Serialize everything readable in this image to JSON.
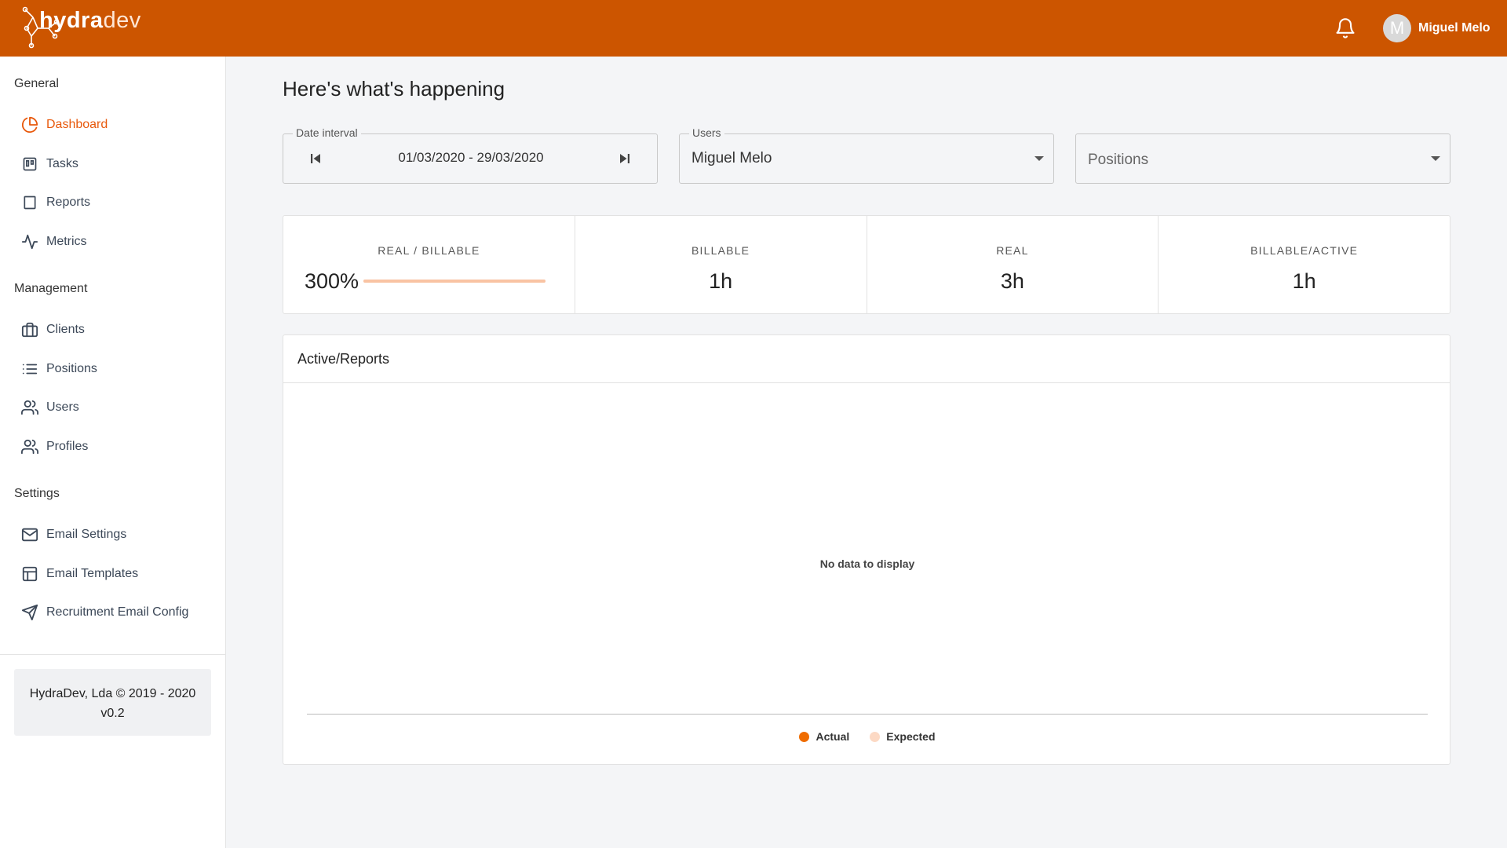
{
  "header": {
    "logo_text_bold": "hydra",
    "logo_text_light": "dev",
    "user_name": "Miguel Melo",
    "avatar_initial": "M",
    "brand_color": "#cc5500"
  },
  "sidebar": {
    "sections": {
      "general": "General",
      "management": "Management",
      "settings": "Settings"
    },
    "items": [
      {
        "label": "Dashboard",
        "icon": "pie-chart-icon",
        "active": true
      },
      {
        "label": "Tasks",
        "icon": "kanban-icon"
      },
      {
        "label": "Reports",
        "icon": "document-icon"
      },
      {
        "label": "Metrics",
        "icon": "activity-icon"
      },
      {
        "label": "Clients",
        "icon": "briefcase-icon"
      },
      {
        "label": "Positions",
        "icon": "list-icon"
      },
      {
        "label": "Users",
        "icon": "users-icon"
      },
      {
        "label": "Profiles",
        "icon": "profiles-icon"
      },
      {
        "label": "Email Settings",
        "icon": "mail-icon"
      },
      {
        "label": "Email Templates",
        "icon": "template-icon"
      },
      {
        "label": "Recruitment Email Config",
        "icon": "send-icon"
      }
    ],
    "footer": {
      "copyright": "HydraDev, Lda © 2019 - 2020",
      "version": "v0.2"
    }
  },
  "main": {
    "title": "Here's what's happening",
    "filters": {
      "date_label": "Date interval",
      "date_value": "01/03/2020 - 29/03/2020",
      "users_label": "Users",
      "users_value": "Miguel Melo",
      "positions_placeholder": "Positions"
    },
    "stats": [
      {
        "title": "REAL / BILLABLE",
        "value": "300%",
        "progress": 1.0
      },
      {
        "title": "BILLABLE",
        "value": "1h"
      },
      {
        "title": "REAL",
        "value": "3h"
      },
      {
        "title": "BILLABLE/ACTIVE",
        "value": "1h"
      }
    ],
    "chart": {
      "title": "Active/Reports",
      "empty_message": "No data to display",
      "legend": [
        {
          "name": "Actual",
          "color": "#ef6c00"
        },
        {
          "name": "Expected",
          "color": "#fcd9c4"
        }
      ]
    }
  }
}
